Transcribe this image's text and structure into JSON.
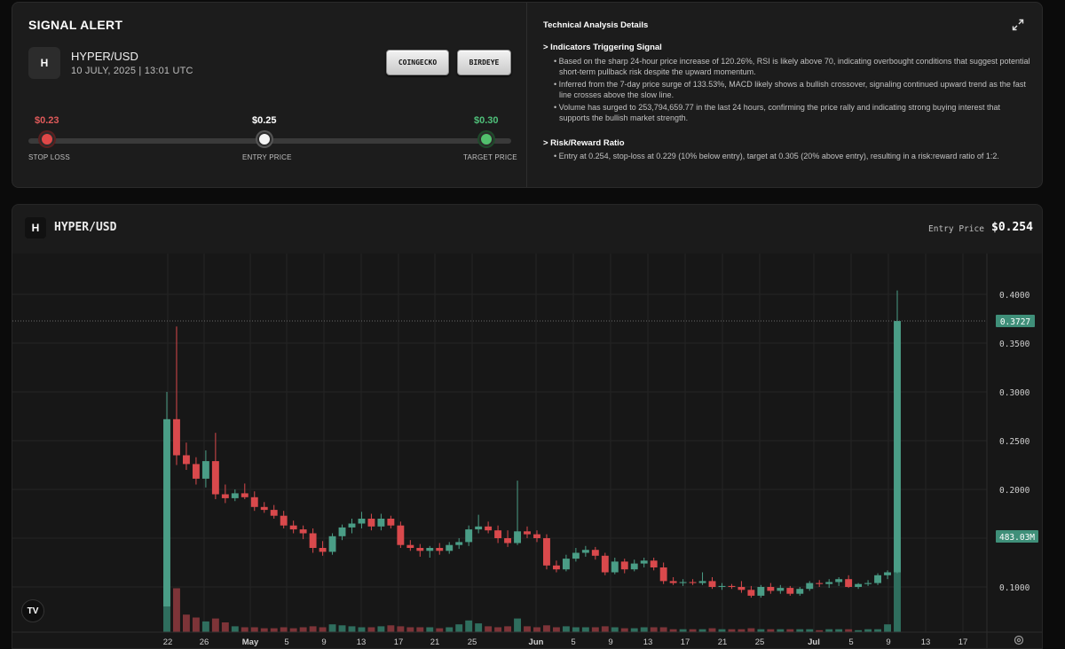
{
  "signal": {
    "title": "SIGNAL ALERT",
    "badge": "H",
    "pair": "HYPER/USD",
    "date": "10 JULY, 2025 | 13:01 UTC",
    "buttons": {
      "coingecko": "COINGECKO",
      "birdeye": "BIRDEYE"
    },
    "range": {
      "stop_loss": "$0.23",
      "entry": "$0.25",
      "target": "$0.30",
      "stop_loss_label": "STOP LOSS",
      "entry_label": "ENTRY PRICE",
      "target_label": "TARGET PRICE"
    },
    "colors": {
      "stop": "#e04848",
      "entry": "#f4f4f4",
      "target": "#52c06d"
    }
  },
  "analysis": {
    "title": "Technical Analysis Details",
    "section1": "> Indicators Triggering Signal",
    "bullets1": [
      "• Based on the sharp 24-hour price increase of 120.26%, RSI is likely above 70, indicating overbought conditions that suggest potential short-term pullback risk despite the upward momentum.",
      "• Inferred from the 7-day price surge of 133.53%, MACD likely shows a bullish crossover, signaling continued upward trend as the fast line crosses above the slow line.",
      "• Volume has surged to 253,794,659.77 in the last 24 hours, confirming the price rally and indicating strong buying interest that supports the bullish market strength."
    ],
    "section2": "> Risk/Reward Ratio",
    "bullets2": [
      "• Entry at 0.254, stop-loss at 0.229 (10% below entry), target at 0.305 (20% above entry), resulting in a risk:reward ratio of 1:2."
    ]
  },
  "chart_header": {
    "badge": "H",
    "pair": "HYPER/USD",
    "entry_label": "Entry Price",
    "entry_value": "$0.254"
  },
  "chart_data": {
    "type": "candlestick",
    "y_ticks": [
      "0.4000",
      "0.3500",
      "0.3000",
      "0.2500",
      "0.2000",
      "0.1000"
    ],
    "x_ticks": [
      "22",
      "26",
      "May",
      "5",
      "9",
      "13",
      "17",
      "21",
      "25",
      "Jun",
      "5",
      "9",
      "13",
      "17",
      "21",
      "25",
      "Jul",
      "5",
      "9",
      "13",
      "17"
    ],
    "last_price_label": "0.3727",
    "volume_label": "483.03M",
    "colors": {
      "up": "#4a9d86",
      "down": "#d9494c",
      "up_volume": "#2f6e5e",
      "down_volume": "#7d3438"
    },
    "candles": [
      [
        0.08,
        0.3,
        0.08,
        0.272
      ],
      [
        0.272,
        0.367,
        0.225,
        0.235
      ],
      [
        0.235,
        0.248,
        0.22,
        0.226
      ],
      [
        0.226,
        0.233,
        0.205,
        0.211
      ],
      [
        0.211,
        0.24,
        0.202,
        0.229
      ],
      [
        0.229,
        0.258,
        0.19,
        0.195
      ],
      [
        0.195,
        0.205,
        0.186,
        0.191
      ],
      [
        0.191,
        0.2,
        0.188,
        0.196
      ],
      [
        0.196,
        0.206,
        0.19,
        0.192
      ],
      [
        0.192,
        0.198,
        0.178,
        0.182
      ],
      [
        0.182,
        0.187,
        0.176,
        0.179
      ],
      [
        0.179,
        0.184,
        0.17,
        0.173
      ],
      [
        0.173,
        0.178,
        0.16,
        0.163
      ],
      [
        0.163,
        0.168,
        0.155,
        0.159
      ],
      [
        0.159,
        0.163,
        0.149,
        0.155
      ],
      [
        0.155,
        0.16,
        0.135,
        0.14
      ],
      [
        0.14,
        0.147,
        0.132,
        0.136
      ],
      [
        0.136,
        0.155,
        0.133,
        0.152
      ],
      [
        0.152,
        0.164,
        0.148,
        0.161
      ],
      [
        0.161,
        0.17,
        0.155,
        0.165
      ],
      [
        0.165,
        0.177,
        0.16,
        0.17
      ],
      [
        0.17,
        0.175,
        0.158,
        0.162
      ],
      [
        0.162,
        0.175,
        0.158,
        0.17
      ],
      [
        0.17,
        0.173,
        0.16,
        0.163
      ],
      [
        0.163,
        0.167,
        0.14,
        0.143
      ],
      [
        0.143,
        0.148,
        0.137,
        0.14
      ],
      [
        0.14,
        0.144,
        0.131,
        0.137
      ],
      [
        0.137,
        0.142,
        0.13,
        0.14
      ],
      [
        0.14,
        0.145,
        0.133,
        0.137
      ],
      [
        0.137,
        0.146,
        0.134,
        0.143
      ],
      [
        0.143,
        0.15,
        0.139,
        0.146
      ],
      [
        0.146,
        0.163,
        0.142,
        0.159
      ],
      [
        0.159,
        0.174,
        0.155,
        0.162
      ],
      [
        0.162,
        0.167,
        0.155,
        0.158
      ],
      [
        0.158,
        0.163,
        0.145,
        0.15
      ],
      [
        0.15,
        0.158,
        0.141,
        0.145
      ],
      [
        0.145,
        0.209,
        0.143,
        0.157
      ],
      [
        0.157,
        0.162,
        0.15,
        0.154
      ],
      [
        0.154,
        0.158,
        0.146,
        0.15
      ],
      [
        0.15,
        0.154,
        0.118,
        0.122
      ],
      [
        0.122,
        0.127,
        0.115,
        0.118
      ],
      [
        0.118,
        0.133,
        0.116,
        0.129
      ],
      [
        0.129,
        0.14,
        0.126,
        0.135
      ],
      [
        0.135,
        0.142,
        0.131,
        0.138
      ],
      [
        0.138,
        0.141,
        0.128,
        0.132
      ],
      [
        0.132,
        0.135,
        0.112,
        0.115
      ],
      [
        0.115,
        0.13,
        0.113,
        0.126
      ],
      [
        0.126,
        0.129,
        0.114,
        0.118
      ],
      [
        0.118,
        0.128,
        0.116,
        0.124
      ],
      [
        0.124,
        0.13,
        0.12,
        0.127
      ],
      [
        0.127,
        0.13,
        0.117,
        0.12
      ],
      [
        0.12,
        0.125,
        0.103,
        0.106
      ],
      [
        0.106,
        0.11,
        0.102,
        0.104
      ],
      [
        0.104,
        0.108,
        0.101,
        0.105
      ],
      [
        0.105,
        0.108,
        0.102,
        0.104
      ],
      [
        0.104,
        0.115,
        0.102,
        0.106
      ],
      [
        0.106,
        0.11,
        0.098,
        0.1
      ],
      [
        0.1,
        0.104,
        0.097,
        0.101
      ],
      [
        0.101,
        0.103,
        0.098,
        0.1
      ],
      [
        0.1,
        0.106,
        0.094,
        0.097
      ],
      [
        0.097,
        0.101,
        0.089,
        0.091
      ],
      [
        0.091,
        0.102,
        0.089,
        0.1
      ],
      [
        0.1,
        0.104,
        0.093,
        0.096
      ],
      [
        0.096,
        0.102,
        0.093,
        0.099
      ],
      [
        0.099,
        0.101,
        0.091,
        0.093
      ],
      [
        0.093,
        0.1,
        0.091,
        0.098
      ],
      [
        0.098,
        0.106,
        0.096,
        0.104
      ],
      [
        0.104,
        0.107,
        0.1,
        0.103
      ],
      [
        0.103,
        0.108,
        0.099,
        0.105
      ],
      [
        0.105,
        0.11,
        0.101,
        0.108
      ],
      [
        0.108,
        0.112,
        0.099,
        0.1
      ],
      [
        0.1,
        0.104,
        0.098,
        0.103
      ],
      [
        0.103,
        0.107,
        0.101,
        0.104
      ],
      [
        0.104,
        0.114,
        0.102,
        0.112
      ],
      [
        0.112,
        0.117,
        0.108,
        0.115
      ],
      [
        0.115,
        0.404,
        0.114,
        0.3727
      ]
    ],
    "volumes": [
      0.55,
      0.45,
      0.18,
      0.15,
      0.11,
      0.14,
      0.1,
      0.06,
      0.05,
      0.05,
      0.04,
      0.04,
      0.05,
      0.04,
      0.05,
      0.06,
      0.05,
      0.08,
      0.07,
      0.06,
      0.05,
      0.05,
      0.06,
      0.07,
      0.06,
      0.05,
      0.05,
      0.05,
      0.04,
      0.05,
      0.08,
      0.12,
      0.09,
      0.06,
      0.05,
      0.06,
      0.14,
      0.06,
      0.05,
      0.07,
      0.05,
      0.06,
      0.05,
      0.05,
      0.05,
      0.06,
      0.05,
      0.04,
      0.04,
      0.05,
      0.05,
      0.05,
      0.03,
      0.03,
      0.03,
      0.03,
      0.04,
      0.03,
      0.03,
      0.03,
      0.04,
      0.03,
      0.03,
      0.03,
      0.03,
      0.03,
      0.03,
      0.02,
      0.03,
      0.03,
      0.03,
      0.02,
      0.03,
      0.03,
      0.08,
      0.75
    ],
    "volume_up": [
      true,
      false,
      false,
      false,
      true,
      false,
      false,
      true,
      false,
      false,
      false,
      false,
      false,
      false,
      false,
      false,
      false,
      true,
      true,
      true,
      true,
      false,
      true,
      false,
      false,
      false,
      false,
      true,
      false,
      true,
      true,
      true,
      true,
      false,
      false,
      false,
      true,
      false,
      false,
      false,
      false,
      true,
      true,
      true,
      false,
      false,
      true,
      false,
      true,
      true,
      false,
      false,
      false,
      true,
      false,
      true,
      false,
      true,
      false,
      false,
      false,
      true,
      false,
      true,
      false,
      true,
      true,
      false,
      true,
      true,
      false,
      true,
      true,
      true,
      true,
      true
    ]
  }
}
